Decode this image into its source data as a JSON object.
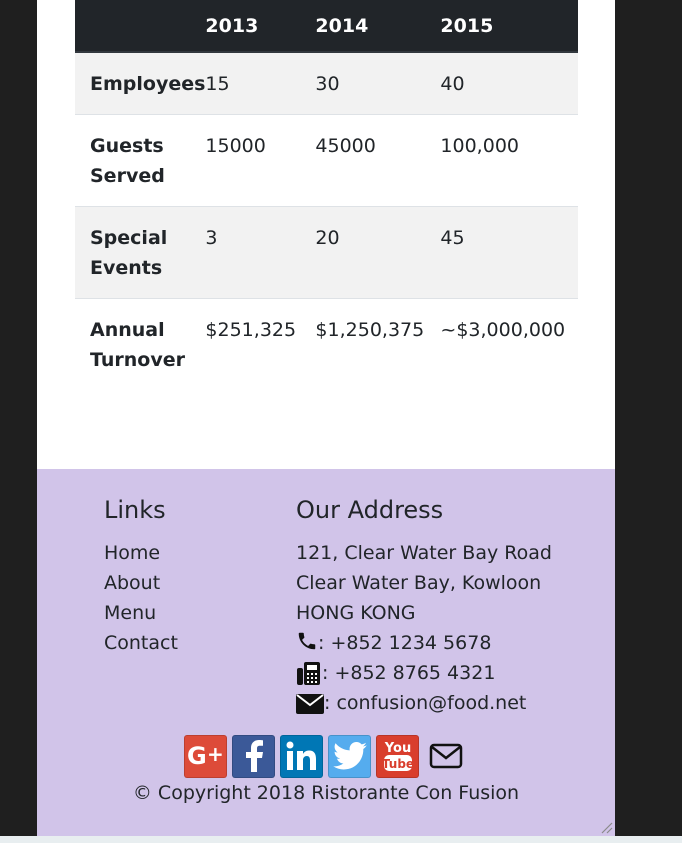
{
  "table": {
    "headers": [
      "",
      "2013",
      "2014",
      "2015"
    ],
    "rows": [
      {
        "label": "Employees",
        "values": [
          "15",
          "30",
          "40"
        ]
      },
      {
        "label": "Guests Served",
        "values": [
          "15000",
          "45000",
          "100,000"
        ]
      },
      {
        "label": "Special Events",
        "values": [
          "3",
          "20",
          "45"
        ]
      },
      {
        "label": "Annual Turnover",
        "values": [
          "$251,325",
          "$1,250,375",
          "~$3,000,000"
        ]
      }
    ]
  },
  "footer": {
    "links_title": "Links",
    "links": [
      "Home",
      "About",
      "Menu",
      "Contact"
    ],
    "address_title": "Our Address",
    "address_lines": [
      "121, Clear Water Bay Road",
      "Clear Water Bay, Kowloon",
      "HONG KONG"
    ],
    "phone": ": +852 1234 5678",
    "fax": ": +852 8765 4321",
    "email": ": confusion@food.net",
    "copyright": "© Copyright 2018 Ristorante Con Fusion",
    "social_icons": [
      "google-plus-icon",
      "facebook-icon",
      "linkedin-icon",
      "twitter-icon",
      "youtube-icon",
      "envelope-icon"
    ]
  },
  "colors": {
    "table_header_bg": "#212529",
    "footer_bg": "#d1c4e9",
    "google_plus": "#dd4b39",
    "facebook": "#3b5998",
    "linkedin": "#0077b5",
    "twitter": "#55acee",
    "youtube": "#d93e2d"
  }
}
